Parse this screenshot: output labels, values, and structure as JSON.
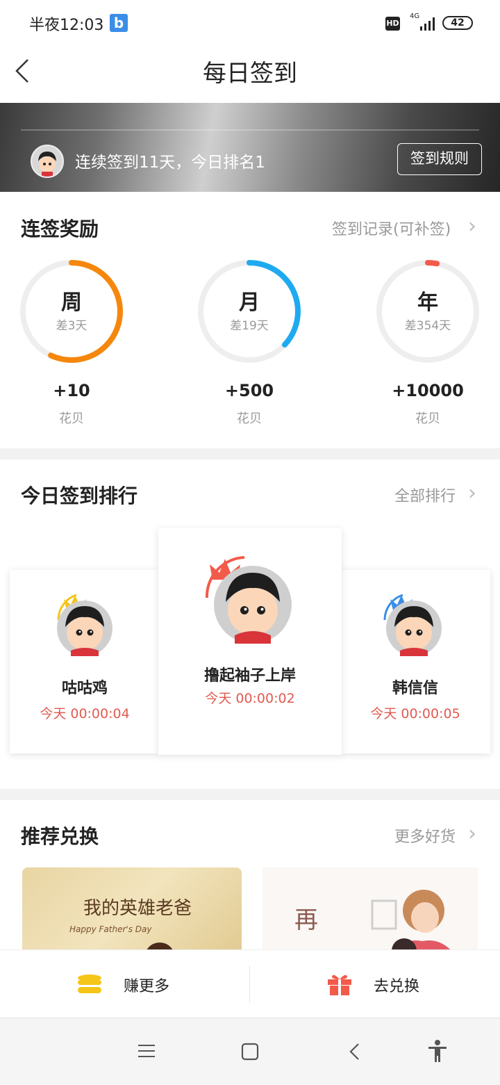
{
  "status": {
    "time": "半夜12:03",
    "app_badge": "b",
    "hd": "HD",
    "network": "4G",
    "battery": "42"
  },
  "nav": {
    "title": "每日签到"
  },
  "banner": {
    "text": "连续签到11天，今日排名1",
    "rules_button": "签到规则"
  },
  "streak": {
    "title": "连签奖励",
    "link": "签到记录(可补签)",
    "rings": [
      {
        "label": "周",
        "sub": "差3天",
        "reward": "+10",
        "unit": "花贝",
        "color": "#f5870c",
        "progress": 0.57
      },
      {
        "label": "月",
        "sub": "差19天",
        "reward": "+500",
        "unit": "花贝",
        "color": "#1eaaf0",
        "progress": 0.37
      },
      {
        "label": "年",
        "sub": "差354天",
        "reward": "+10000",
        "unit": "花贝",
        "color": "#f25a4a",
        "progress": 0.03
      }
    ]
  },
  "ranking": {
    "title": "今日签到排行",
    "link": "全部排行",
    "entries": [
      {
        "name": "咕咕鸡",
        "time": "今天 00:00:04",
        "crown_color": "#f5c518"
      },
      {
        "name": "撸起袖子上岸",
        "time": "今天 00:00:02",
        "crown_color": "#f25a4a"
      },
      {
        "name": "韩信信",
        "time": "今天 00:00:05",
        "crown_color": "#3a8ee6"
      }
    ]
  },
  "recommend": {
    "title": "推荐兑换",
    "link": "更多好货",
    "item1_text": "我的英雄老爸",
    "item1_sub": "Happy Father's Day",
    "item2_text": "再"
  },
  "actions": {
    "earn": "赚更多",
    "exchange": "去兑换",
    "earn_color": "#f5c518",
    "exchange_color": "#f25a4a"
  }
}
